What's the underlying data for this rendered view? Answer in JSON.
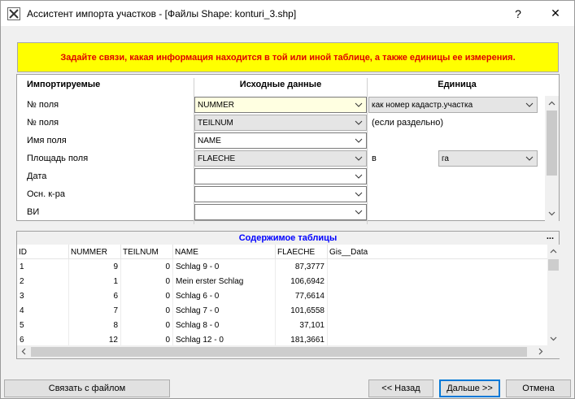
{
  "window": {
    "title": "Ассистент импорта участков - [Файлы Shape: konturi_3.shp]",
    "help_label": "?",
    "close_label": "✕"
  },
  "banner": {
    "text": "Задайте связи, какая информация находится в той или иной таблице, а также единицы ее измерения."
  },
  "mapping": {
    "headers": {
      "imported": "Импортируемые",
      "source": "Исходные данные",
      "unit": "Единица"
    },
    "rows": [
      {
        "label": "№ поля",
        "value": "NUMMER"
      },
      {
        "label": "№ поля",
        "value": "TEILNUM"
      },
      {
        "label": "Имя поля",
        "value": "NAME"
      },
      {
        "label": "Площадь поля",
        "value": "FLAECHE"
      },
      {
        "label": "Дата",
        "value": ""
      },
      {
        "label": "Осн. к-ра",
        "value": ""
      },
      {
        "label": "ВИ",
        "value": ""
      }
    ],
    "unit_row1": "как номер кадастр.участка",
    "unit_row2": "(если раздельно)",
    "unit_row4_prefix": "в",
    "unit_row4_value": "га"
  },
  "table": {
    "title": "Содержимое таблицы",
    "menu_label": "...",
    "columns": [
      "ID",
      "NUMMER",
      "TEILNUM",
      "NAME",
      "FLAECHE",
      "Gis__Data"
    ],
    "rows": [
      [
        "1",
        "9",
        "0",
        "Schlag 9 - 0",
        "87,3777",
        ""
      ],
      [
        "2",
        "1",
        "0",
        "Mein erster Schlag",
        "106,6942",
        ""
      ],
      [
        "3",
        "6",
        "0",
        "Schlag 6 - 0",
        "77,6614",
        ""
      ],
      [
        "4",
        "7",
        "0",
        "Schlag 7 - 0",
        "101,6558",
        ""
      ],
      [
        "5",
        "8",
        "0",
        "Schlag 8 - 0",
        "37,101",
        ""
      ],
      [
        "6",
        "12",
        "0",
        "Schlag 12 - 0",
        "181,3661",
        ""
      ]
    ]
  },
  "buttons": {
    "link_file": "Связать с файлом",
    "back": "<< Назад",
    "next": "Дальше  >>",
    "cancel": "Отмена"
  }
}
